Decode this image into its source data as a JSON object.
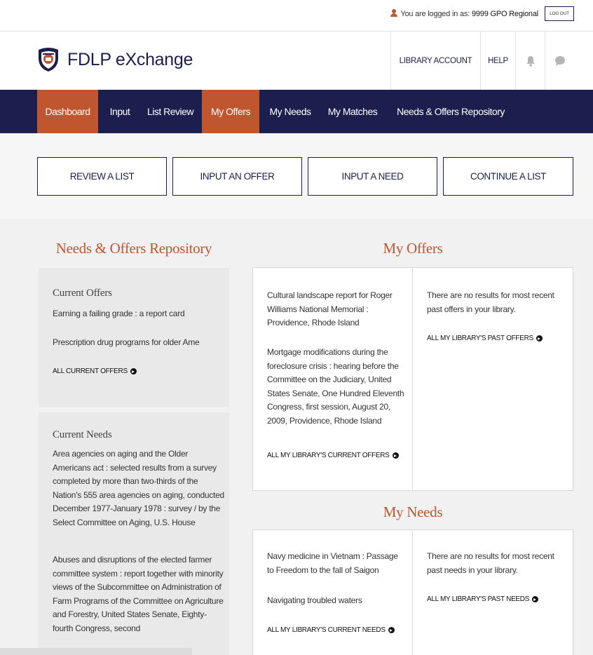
{
  "topbar": {
    "login_prefix": "You are logged in as:",
    "login_user": "9999 GPO Regional",
    "logout_label": "LOG OUT"
  },
  "header": {
    "app_title": "FDLP eXchange",
    "library_account_label": "LIBRARY ACCOUNT",
    "help_label": "HELP",
    "bell_icon": "bell-icon",
    "chat_icon": "chat-icon"
  },
  "nav": {
    "items": [
      {
        "label": "Dashboard",
        "active": true
      },
      {
        "label": "Input",
        "active": false
      },
      {
        "label": "List Review",
        "active": false
      },
      {
        "label": "My Offers",
        "active": true
      },
      {
        "label": "My Needs",
        "active": false
      },
      {
        "label": "My Matches",
        "active": false
      },
      {
        "label": "Needs & Offers Repository",
        "active": false
      }
    ]
  },
  "actions": {
    "review_list": "REVIEW A LIST",
    "input_offer": "INPUT AN OFFER",
    "input_need": "INPUT A NEED",
    "continue_list": "CONTINUE A LIST"
  },
  "repository": {
    "title": "Needs & Offers Repository",
    "current_offers_heading": "Current Offers",
    "current_offers": [
      "Earning a failing grade : a report card",
      "Prescription drug programs for older Ame"
    ],
    "all_current_offers_link": "ALL CURRENT OFFERS",
    "current_needs_heading": "Current Needs",
    "current_needs": [
      "Area agencies on aging and the Older Americans act : selected results from a survey completed by more than two-thirds of the Nation's 555 area agencies on aging, conducted December 1977-January 1978 : survey / by the Select Committee on Aging, U.S. House",
      "Abuses and disruptions of the elected farmer committee system : report together with minority views of the Subcommittee on Administration of Farm Programs of the Committee on Agriculture and Forestry, United States Senate, Eighty-fourth Congress, second"
    ]
  },
  "my_offers": {
    "title": "My Offers",
    "current": [
      "Cultural landscape report for Roger Williams National Memorial : Providence, Rhode Island",
      "Mortgage modifications during the foreclosure crisis : hearing before the Committee on the Judiciary, United States Senate, One Hundred Eleventh Congress, first session, August 20, 2009, Providence, Rhode Island"
    ],
    "current_link": "ALL MY LIBRARY'S CURRENT OFFERS",
    "past_empty": "There are no results for most recent past offers in your library.",
    "past_link": "ALL MY LIBRARY'S PAST OFFERS"
  },
  "my_needs": {
    "title": "My Needs",
    "current": [
      "Navy medicine in Vietnam : Passage to Freedom to the fall of Saigon",
      "Navigating troubled waters"
    ],
    "current_link": "ALL MY LIBRARY'S CURRENT NEEDS",
    "past_empty": "There are no results for most recent past needs in your library.",
    "past_link": "ALL MY LIBRARY'S PAST NEEDS"
  },
  "colors": {
    "navy": "#1c1e4e",
    "accent": "#c0562f"
  }
}
